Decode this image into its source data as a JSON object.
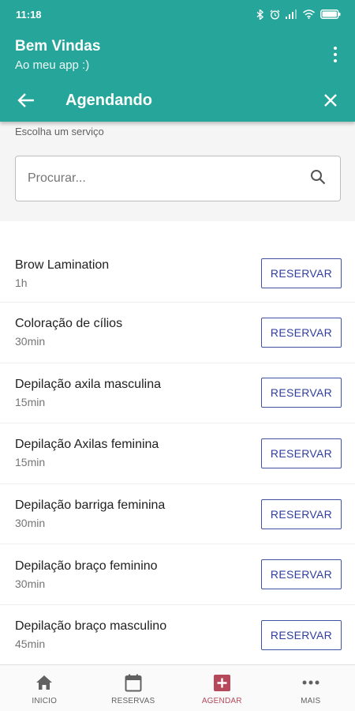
{
  "status_bar": {
    "time": "11:18",
    "icons": [
      "bluetooth-icon",
      "alarm-icon",
      "signal-icon",
      "wifi-icon",
      "battery-icon"
    ]
  },
  "app_bar": {
    "title": "Bem Vindas",
    "subtitle": "Ao meu app :)",
    "menu_icon": "more-vert-icon"
  },
  "sub_bar": {
    "title": "Agendando",
    "back_icon": "arrow-back-icon",
    "close_icon": "close-icon"
  },
  "search": {
    "label": "Escolha um serviço",
    "placeholder": "Procurar...",
    "value": "",
    "icon": "search-icon"
  },
  "services": [
    {
      "name": "Brow Lamination",
      "duration": "1h",
      "action": "RESERVAR"
    },
    {
      "name": "Coloração de cílios",
      "duration": "30min",
      "action": "RESERVAR"
    },
    {
      "name": "Depilação axila masculina",
      "duration": "15min",
      "action": "RESERVAR"
    },
    {
      "name": "Depilação Axilas feminina",
      "duration": "15min",
      "action": "RESERVAR"
    },
    {
      "name": "Depilação barriga feminina",
      "duration": "30min",
      "action": "RESERVAR"
    },
    {
      "name": "Depilação braço feminino",
      "duration": "30min",
      "action": "RESERVAR"
    },
    {
      "name": "Depilação braço masculino",
      "duration": "45min",
      "action": "RESERVAR"
    }
  ],
  "bottom_nav": {
    "items": [
      {
        "label": "INICIO",
        "icon": "home-icon",
        "active": false
      },
      {
        "label": "RESERVAS",
        "icon": "calendar-icon",
        "active": false
      },
      {
        "label": "AGENDAR",
        "icon": "add-box-icon",
        "active": true
      },
      {
        "label": "MAIS",
        "icon": "more-horiz-icon",
        "active": false
      }
    ]
  },
  "colors": {
    "primary": "#26a69a",
    "button_text": "#2f3e9e",
    "active_nav": "#b5495b"
  }
}
